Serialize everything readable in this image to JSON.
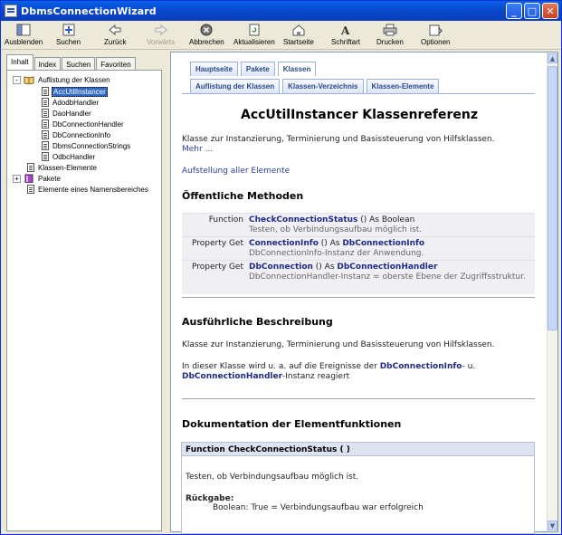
{
  "window": {
    "title": "DbmsConnectionWizard"
  },
  "toolbar": {
    "buttons": [
      {
        "label": "Ausblenden",
        "icon": "hide-pane-icon"
      },
      {
        "label": "Suchen",
        "icon": "locate-icon"
      },
      {
        "label": "Zurück",
        "icon": "back-arrow-icon"
      },
      {
        "label": "Vorwärts",
        "icon": "forward-arrow-icon"
      },
      {
        "label": "Abbrechen",
        "icon": "stop-icon"
      },
      {
        "label": "Aktualisieren",
        "icon": "refresh-icon"
      },
      {
        "label": "Startseite",
        "icon": "home-icon"
      },
      {
        "label": "Schriftart",
        "icon": "font-icon"
      },
      {
        "label": "Drucken",
        "icon": "print-icon"
      },
      {
        "label": "Optionen",
        "icon": "options-icon"
      }
    ]
  },
  "left_tabs": [
    "Inhalt",
    "Index",
    "Suchen",
    "Favoriten"
  ],
  "tree": {
    "nodes": [
      {
        "label": "Auflistung der Klassen",
        "icon": "book-open-icon",
        "expander": "-"
      },
      {
        "label": "AccUtilInstancer",
        "icon": "page-icon",
        "selected": true
      },
      {
        "label": "AdodbHandler",
        "icon": "page-icon"
      },
      {
        "label": "DaoHandler",
        "icon": "page-icon"
      },
      {
        "label": "DbConnectionHandler",
        "icon": "page-icon"
      },
      {
        "label": "DbConnectionInfo",
        "icon": "page-icon"
      },
      {
        "label": "DbmsConnectionStrings",
        "icon": "page-icon"
      },
      {
        "label": "OdbcHandler",
        "icon": "page-icon"
      },
      {
        "label": "Klassen-Elemente",
        "icon": "page-icon"
      },
      {
        "label": "Pakete",
        "icon": "book-closed-icon",
        "expander": "+"
      },
      {
        "label": "Elemente eines Namensbereiches",
        "icon": "page-icon"
      }
    ]
  },
  "content": {
    "tabs_top": [
      "Hauptseite",
      "Pakete",
      "Klassen"
    ],
    "tabs_sub": [
      "Auflistung der Klassen",
      "Klassen-Verzeichnis",
      "Klassen-Elemente"
    ],
    "heading": "AccUtilInstancer Klassenreferenz",
    "intro": "Klasse zur Instanzierung, Terminierung und Basissteuerung von Hilfsklassen.",
    "more_link": "Mehr ...",
    "all_members_link": "Aufstellung aller Elemente",
    "public_methods_heading": "Öffentliche Methoden",
    "methods": [
      {
        "type": "Function",
        "name": "CheckConnectionStatus",
        "sig": " () As Boolean",
        "desc": "Testen, ob Verbindungsaufbau möglich ist."
      },
      {
        "type": "Property Get",
        "name": "ConnectionInfo",
        "sig": " () As ",
        "ret": "DbConnectionInfo",
        "desc": "DbConnectionInfo-Instanz der Anwendung."
      },
      {
        "type": "Property Get",
        "name": "DbConnection",
        "sig": " () As ",
        "ret": "DbConnectionHandler",
        "desc": "DbConnectionHandler-Instanz = oberste Ebene der Zugriffsstruktur."
      }
    ],
    "detail_heading": "Ausführliche Beschreibung",
    "detail_text": "Klasse zur Instanzierung, Terminierung und Basissteuerung von Hilfsklassen.",
    "detail_p2_pre": "In dieser Klasse wird u. a. auf die Ereignisse der ",
    "detail_p2_link1": "DbConnectionInfo",
    "detail_p2_mid": "- u.",
    "detail_p2_link2": "DbConnectionHandler",
    "detail_p2_post": "-Instanz reagiert",
    "doc_heading": "Dokumentation der Elementfunktionen",
    "func_header": "Function CheckConnectionStatus (   )",
    "func_desc": "Testen, ob Verbindungsaufbau möglich ist.",
    "return_label": "Rückgabe:",
    "return_text": "Boolean: True = Verbindungsaufbau war erfolgreich"
  }
}
